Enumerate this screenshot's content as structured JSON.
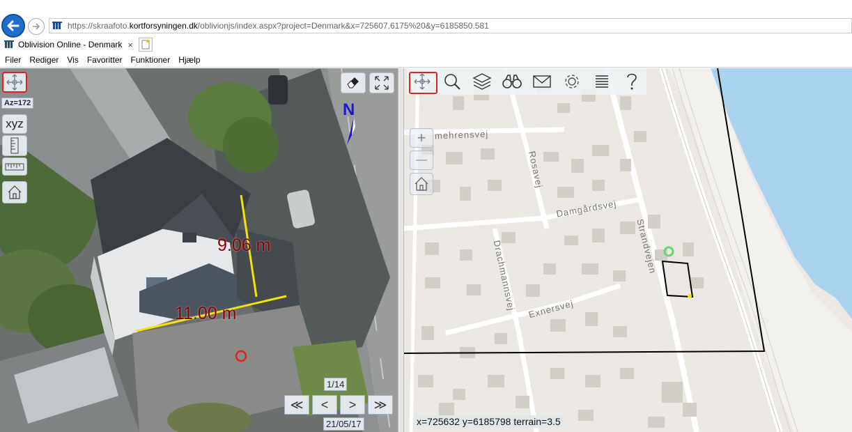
{
  "browser": {
    "url_prefix": "https://skraafoto.",
    "url_domain": "kortforsyningen.dk",
    "url_rest": "/oblivionjs/index.aspx?project=Denmark&x=725607.6175%20&y=6185850.581",
    "tab_title": "Oblivision Online - Denmark",
    "tab_close": "×"
  },
  "menu": [
    "Filer",
    "Rediger",
    "Vis",
    "Favoritter",
    "Funktioner",
    "Hjælp"
  ],
  "aerial": {
    "az_label": "Az=172",
    "xyz_label": "xyz",
    "north_label": "N",
    "measure_1": "9.06 m",
    "measure_2": "11.00 m",
    "image_counter": "1/14",
    "image_date": "21/05/17",
    "nav": {
      "first": "≪",
      "prev": "<",
      "next": ">",
      "last": "≫"
    }
  },
  "map": {
    "streets": {
      "mehrensvej": "mehrensvej",
      "rosavej": "Rosavej",
      "damgardsvej": "Damgårdsvej",
      "strandvejen": "Strandvejen",
      "drachmannsvej": "Drachmannsvej",
      "exnersvej": "Exnersvej"
    },
    "zoom_in": "+",
    "zoom_out": "—",
    "coordinates": "x=725632 y=6185798 terrain=3.5"
  },
  "colors": {
    "measure_line": "#f2e600",
    "measure_text": "#8b0000",
    "water": "#a9d2ee",
    "active_border": "#dd2222",
    "marker_circle": "#dd2222",
    "map_marker_green": "#6fd46f"
  },
  "icons": {
    "pan": "pan-arrows-icon",
    "search": "magnifier-icon",
    "layers": "layers-icon",
    "binoculars": "binoculars-icon",
    "mail": "envelope-icon",
    "settings": "gear-icon",
    "list": "list-icon",
    "help": "question-icon",
    "home": "home-icon",
    "eraser": "eraser-icon",
    "fullscreen": "fullscreen-icon",
    "ruler": "ruler-icon"
  }
}
